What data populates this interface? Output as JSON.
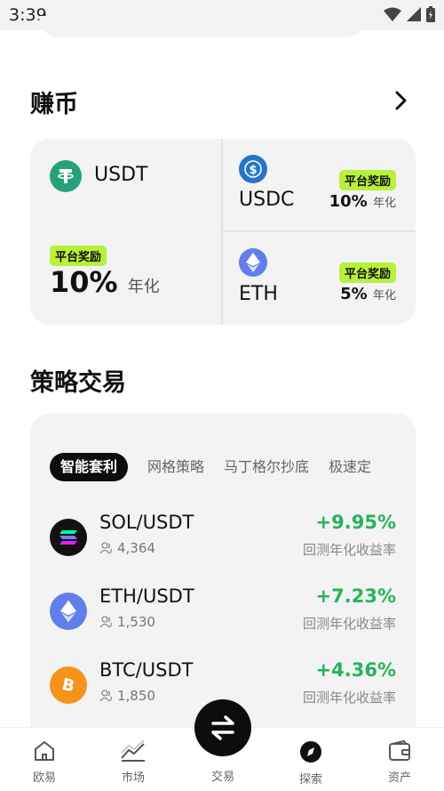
{
  "status_bar": {
    "time": "3:39"
  },
  "earn": {
    "title": "赚币",
    "main": {
      "coin": "USDT",
      "badge": "平台奖励",
      "rate": "10%",
      "rate_unit": "年化",
      "color": "#26a17b"
    },
    "side": [
      {
        "coin": "USDC",
        "badge": "平台奖励",
        "rate": "10%",
        "rate_unit": "年化",
        "color": "#2775ca"
      },
      {
        "coin": "ETH",
        "badge": "平台奖励",
        "rate": "5%",
        "rate_unit": "年化",
        "color": "#627eea"
      }
    ]
  },
  "strategy": {
    "title": "策略交易",
    "tabs": [
      "智能套利",
      "网格策略",
      "马丁格尔抄底",
      "极速定"
    ],
    "active_tab": 0,
    "rows": [
      {
        "pair": "SOL/USDT",
        "users": "4,364",
        "pct": "+9.95%",
        "pct_label": "回测年化收益率",
        "icon": "solana-icon"
      },
      {
        "pair": "ETH/USDT",
        "users": "1,530",
        "pct": "+7.23%",
        "pct_label": "回测年化收益率",
        "icon": "ethereum-icon"
      },
      {
        "pair": "BTC/USDT",
        "users": "1,850",
        "pct": "+4.36%",
        "pct_label": "回测年化收益率",
        "icon": "bitcoin-icon"
      }
    ]
  },
  "nav": {
    "items": [
      {
        "label": "欧易",
        "icon": "home-icon"
      },
      {
        "label": "市场",
        "icon": "market-chart-icon"
      },
      {
        "label": "交易",
        "icon": "swap-icon"
      },
      {
        "label": "探索",
        "icon": "compass-icon"
      },
      {
        "label": "资产",
        "icon": "wallet-icon"
      }
    ],
    "active": 3
  },
  "colors": {
    "accent_green": "#27b35a",
    "badge_lime": "#b8f13a",
    "card_bg": "#f3f3f3"
  }
}
